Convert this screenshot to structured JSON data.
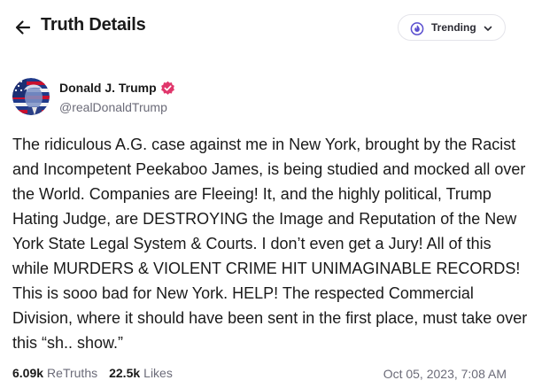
{
  "header": {
    "title": "Truth Details",
    "back_icon": "arrow-left-icon",
    "trending": {
      "label": "Trending",
      "icon": "trending-flame-icon",
      "dropdown_icon": "chevron-down-icon"
    }
  },
  "post": {
    "author": {
      "name": "Donald J. Trump",
      "handle": "@realDonaldTrump",
      "verified": true,
      "avatar_icon": "profile-avatar"
    },
    "text": "The ridiculous A.G. case against me in New York, brought by the Racist and Incompetent Peekaboo James, is being studied and mocked all over the World. Companies are Fleeing! It, and the highly political, Trump Hating Judge, are DESTROYING the Image and Reputation of the New York State Legal System & Courts. I don’t even get a Jury! All of this while MURDERS & VIOLENT CRIME HIT UNIMAGINABLE RECORDS! This is sooo bad for New York. HELP! The respected Commercial Division, where it should have been sent in the first place, must take over this “sh.. show.”",
    "stats": {
      "retruths_count": "6.09k",
      "retruths_label": "ReTruths",
      "likes_count": "22.5k",
      "likes_label": "Likes"
    },
    "timestamp": "Oct 05, 2023, 7:08 AM"
  },
  "colors": {
    "verified_badge": "#e0366b",
    "trending_icon": "#5a4fcf",
    "muted_text": "#6b6b78",
    "primary_text": "#1a1a1a"
  }
}
